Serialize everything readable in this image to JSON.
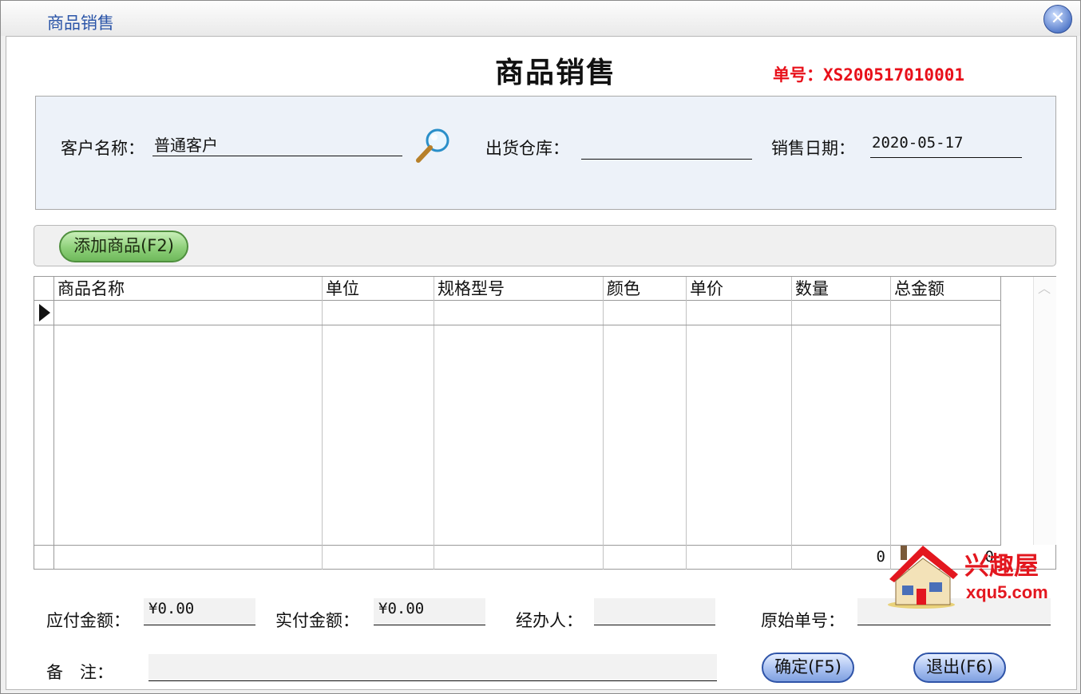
{
  "window": {
    "title": "商品销售",
    "close_glyph": "✕"
  },
  "form": {
    "title": "商品销售",
    "order_no": "单号：XS200517010001"
  },
  "customer": {
    "name_label": "客户名称：",
    "name_value": "普通客户",
    "warehouse_label": "出货仓库：",
    "warehouse_value": "",
    "date_label": "销售日期：",
    "date_value": "2020-05-17"
  },
  "toolbar": {
    "add_label": "添加商品(F2)"
  },
  "grid": {
    "columns": [
      "商品名称",
      "单位",
      "规格型号",
      "颜色",
      "单价",
      "数量",
      "总金额"
    ],
    "rows": [
      {
        "name": "",
        "unit": "",
        "spec": "",
        "color": "",
        "price": "",
        "qty": "",
        "total": ""
      }
    ],
    "footer": {
      "qty_total": "0",
      "amount_total": "0"
    }
  },
  "summary": {
    "payable_label": "应付金额：",
    "payable_value": "¥0.00",
    "paid_label": "实付金额：",
    "paid_value": "¥0.00",
    "handler_label": "经办人：",
    "handler_value": "",
    "origin_label": "原始单号：",
    "origin_value": "",
    "remark_label": "备　注：",
    "remark_value": ""
  },
  "actions": {
    "confirm_label": "确定(F5)",
    "exit_label": "退出(F6)"
  },
  "watermark": {
    "cn": "兴趣屋",
    "en": "xqu5.com"
  },
  "colors": {
    "accent_red": "#e8101a",
    "title_blue": "#2b55a8",
    "panel_bg": "#edf2f9",
    "add_green": "#8ed07a",
    "btn_blue": "#a9c1f1"
  }
}
